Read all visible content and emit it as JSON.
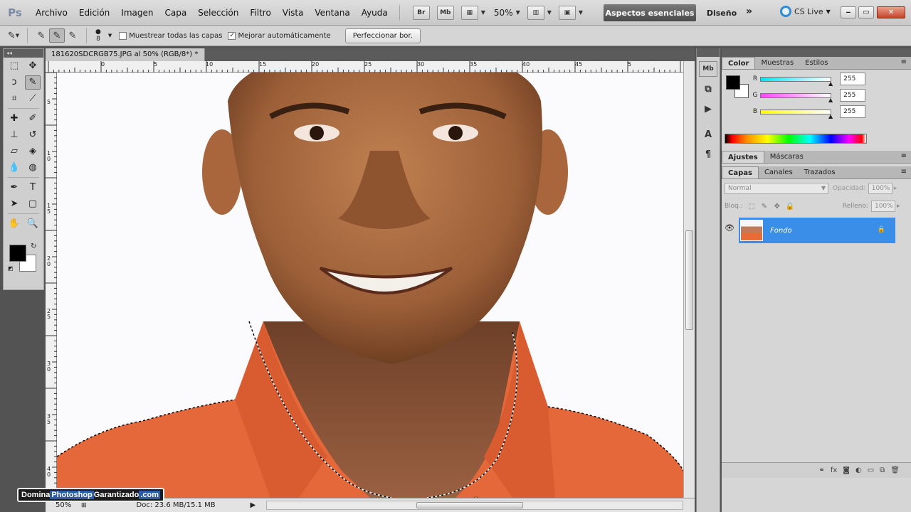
{
  "menubar": {
    "logo": "Ps",
    "items": [
      "Archivo",
      "Edición",
      "Imagen",
      "Capa",
      "Selección",
      "Filtro",
      "Vista",
      "Ventana",
      "Ayuda"
    ],
    "bridge_label": "Br",
    "minibridge_label": "Mb",
    "zoom": "50%",
    "workspace_active": "Aspectos esenciales",
    "workspace_other": "Diseño",
    "more": "»",
    "cslive": "CS Live",
    "win_min": "‒",
    "win_max": "▭",
    "win_close": "✕"
  },
  "options": {
    "brush_size": "8",
    "sample_all": "Muestrear todas las capas",
    "sample_all_checked": false,
    "auto_enhance": "Mejorar automáticamente",
    "auto_enhance_checked": true,
    "refine_button": "Perfeccionar bor."
  },
  "document": {
    "tab_title": "181620SDCRGB75.JPG al 50% (RGB/8*) *",
    "tab_close": "×",
    "ruler_top": [
      "0",
      "5",
      "10",
      "15",
      "20",
      "25",
      "30",
      "35",
      "40",
      "45",
      "5"
    ],
    "ruler_left": [
      "5",
      "1\n0",
      "1\n5",
      "2\n0",
      "2\n5",
      "3\n0",
      "3\n5",
      "4\n0"
    ],
    "zoom_status": "50%",
    "doc_info": "Doc: 23.6 MB/15.1 MB"
  },
  "watermark": {
    "part1": "Domina",
    "part2": "Photoshop",
    "part3": "Garantizado",
    "part4": ".com"
  },
  "panels": {
    "color_tabs": [
      "Color",
      "Muestras",
      "Estilos"
    ],
    "color_active": "Color",
    "sliders": [
      {
        "label": "R",
        "value": "255",
        "gradient": "linear-gradient(90deg,#00e5ff,#ffffff)"
      },
      {
        "label": "G",
        "value": "255",
        "gradient": "linear-gradient(90deg,#ff44ff,#ffffff)"
      },
      {
        "label": "B",
        "value": "255",
        "gradient": "linear-gradient(90deg,#ffff00,#ffffff)"
      }
    ],
    "adjust_tabs": [
      "Ajustes",
      "Máscaras"
    ],
    "layer_tabs": [
      "Capas",
      "Canales",
      "Trazados"
    ],
    "blend_mode": "Normal",
    "opacity_label": "Opacidad:",
    "opacity_value": "100%",
    "lock_label": "Bloq.:",
    "fill_label": "Relleno:",
    "fill_value": "100%",
    "layer_name": "Fondo"
  },
  "colors": {
    "accent": "#3a8ee7",
    "shirt": "#e4683a",
    "skin": "#a8693f"
  }
}
